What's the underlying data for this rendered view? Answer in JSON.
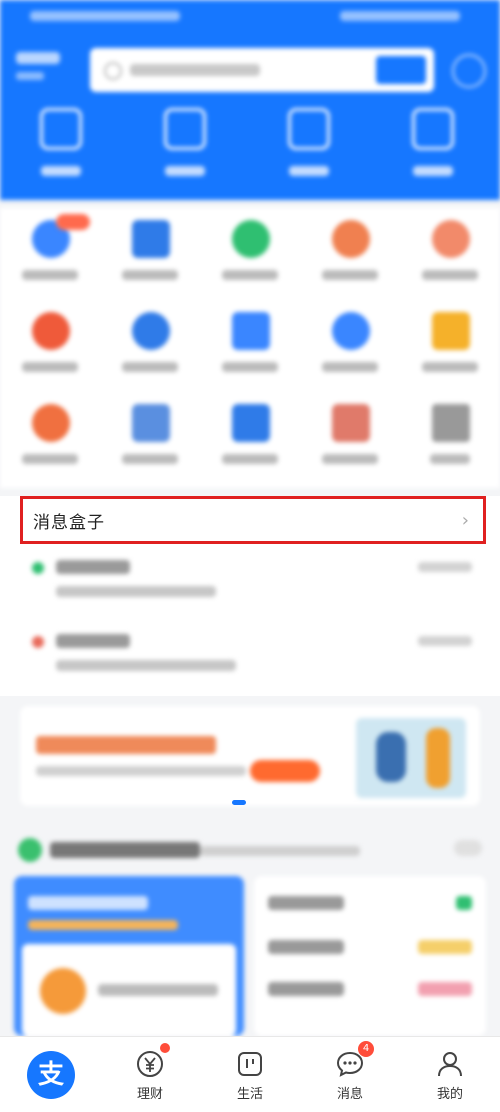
{
  "message_box": {
    "title": "消息盒子",
    "chevron": "›",
    "items": [
      {
        "dot_color": "#2fbf71"
      },
      {
        "dot_color": "#e86a5a"
      }
    ]
  },
  "bottom_nav": {
    "home_glyph": "支",
    "items": [
      {
        "label": ""
      },
      {
        "label": "理财"
      },
      {
        "label": "生活"
      },
      {
        "label": "消息",
        "badge": "4"
      },
      {
        "label": "我的"
      }
    ]
  },
  "colors": {
    "brand_blue": "#1677ff",
    "highlight_red": "#e02020"
  }
}
